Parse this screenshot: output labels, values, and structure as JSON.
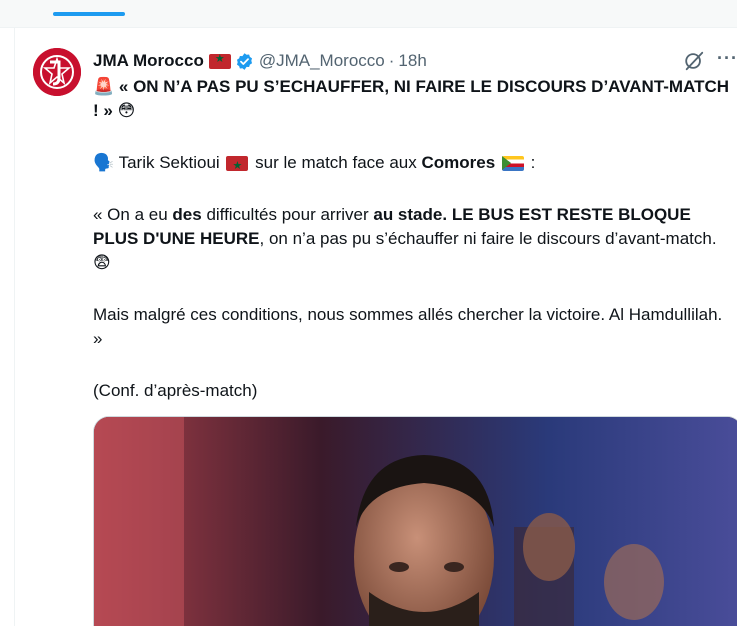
{
  "tweet": {
    "display_name": "JMA Morocco",
    "handle": "@JMA_Morocco",
    "separator": "·",
    "time": "18h",
    "more_label": "···",
    "line1_emoji": "🚨",
    "line1_text": "« ON N’A PAS PU S’ECHAUFFER, NI FAIRE LE DISCOURS D’AVANT-MATCH",
    "line1_end": "! »",
    "line1_end_emoji": "😳",
    "line2_emoji": "🗣️",
    "line2_name": "Tarik Sektioui",
    "line2_mid": "sur le match face aux",
    "line2_team": "Comores",
    "line2_colon": ":",
    "q1": "« On a eu",
    "q2": "des",
    "q3": "difficultés pour arriver",
    "q4": "au stade",
    "q5": ".",
    "q6": "LE BUS EST RESTE BLOQUE PLUS D'UNE HEURE",
    "q7": ", on n’a pas pu s’échauffer ni faire le discours d’avant-match.",
    "q_emoji": "😨",
    "para3": "Mais malgré ces conditions, nous sommes allés chercher la victoire. Al Hamdullilah. »",
    "para4": "(Conf. d’après-match)"
  },
  "colors": {
    "accent": "#1d9bf0",
    "brand_red": "#c8102e",
    "text": "#0f1419",
    "muted": "#536471"
  },
  "icons": {
    "avatar": "jma-logo",
    "verified": "verified-badge-icon",
    "grok": "grok-icon",
    "more": "more-icon"
  }
}
